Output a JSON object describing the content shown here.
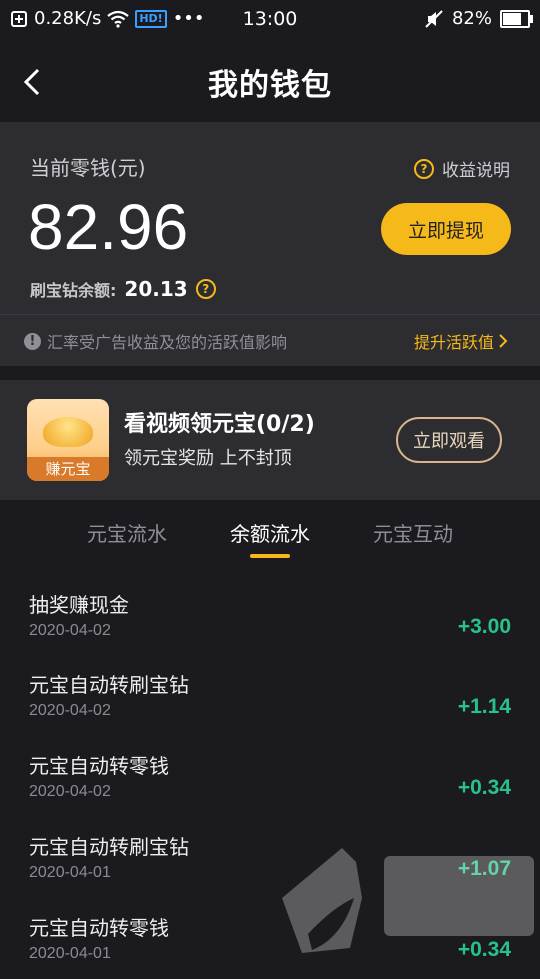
{
  "status_bar": {
    "speed": "0.28K/s",
    "hd_badge": "HD!",
    "more": "•••",
    "time": "13:00",
    "battery": "82%",
    "battery_level": 0.82
  },
  "header": {
    "title": "我的钱包"
  },
  "wallet": {
    "balance_label": "当前零钱(元)",
    "help_label": "收益说明",
    "balance": "82.96",
    "withdraw_label": "立即提现",
    "diamond_label": "刷宝钻余额:",
    "diamond_value": "20.13",
    "notice": "汇率受广告收益及您的活跃值影响",
    "boost_label": "提升活跃值"
  },
  "promo": {
    "image_caption": "赚元宝",
    "title": "看视频领元宝(0/2)",
    "subtitle": "领元宝奖励 上不封顶",
    "button_label": "立即观看"
  },
  "tabs": [
    {
      "label": "元宝流水",
      "active": false
    },
    {
      "label": "余额流水",
      "active": true
    },
    {
      "label": "元宝互动",
      "active": false
    }
  ],
  "transactions": [
    {
      "title": "抽奖赚现金",
      "date": "2020-04-02",
      "amount": "+3.00"
    },
    {
      "title": "元宝自动转刷宝钻",
      "date": "2020-04-02",
      "amount": "+1.14"
    },
    {
      "title": "元宝自动转零钱",
      "date": "2020-04-02",
      "amount": "+0.34"
    },
    {
      "title": "元宝自动转刷宝钻",
      "date": "2020-04-01",
      "amount": "+1.07"
    },
    {
      "title": "元宝自动转零钱",
      "date": "2020-04-01",
      "amount": "+0.34"
    }
  ],
  "colors": {
    "accent": "#f6b91a",
    "positive": "#27c28a",
    "background": "#1b1b1f",
    "card": "#2c2c31"
  }
}
